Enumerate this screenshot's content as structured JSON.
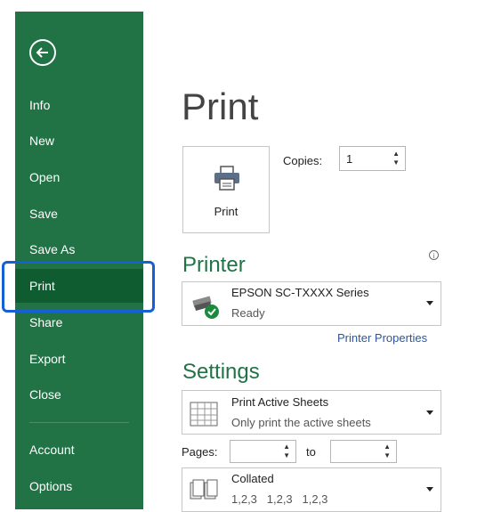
{
  "sidebar": {
    "back_icon": "back-arrow-icon",
    "items": [
      {
        "label": "Info"
      },
      {
        "label": "New"
      },
      {
        "label": "Open"
      },
      {
        "label": "Save"
      },
      {
        "label": "Save As"
      },
      {
        "label": "Print",
        "active": true
      },
      {
        "label": "Share"
      },
      {
        "label": "Export"
      },
      {
        "label": "Close"
      },
      {
        "label": "Account"
      },
      {
        "label": "Options"
      }
    ],
    "bg_color": "#217346",
    "active_color": "#0e5c30"
  },
  "main": {
    "title": "Print",
    "print_button_label": "Print",
    "copies_label": "Copies:",
    "copies_value": "1",
    "printer_heading": "Printer",
    "printer_name": "EPSON SC-TXXXX Series",
    "printer_status": "Ready",
    "printer_properties_link": "Printer Properties",
    "settings_heading": "Settings",
    "setting_scope_title": "Print Active Sheets",
    "setting_scope_sub": "Only print the active sheets",
    "pages_label": "Pages:",
    "pages_to_label": "to",
    "collate_title": "Collated",
    "collate_sub": "1,2,3   1,2,3   1,2,3"
  },
  "colors": {
    "accent": "#217346",
    "focus": "#1560d4",
    "link": "#2b579a"
  }
}
